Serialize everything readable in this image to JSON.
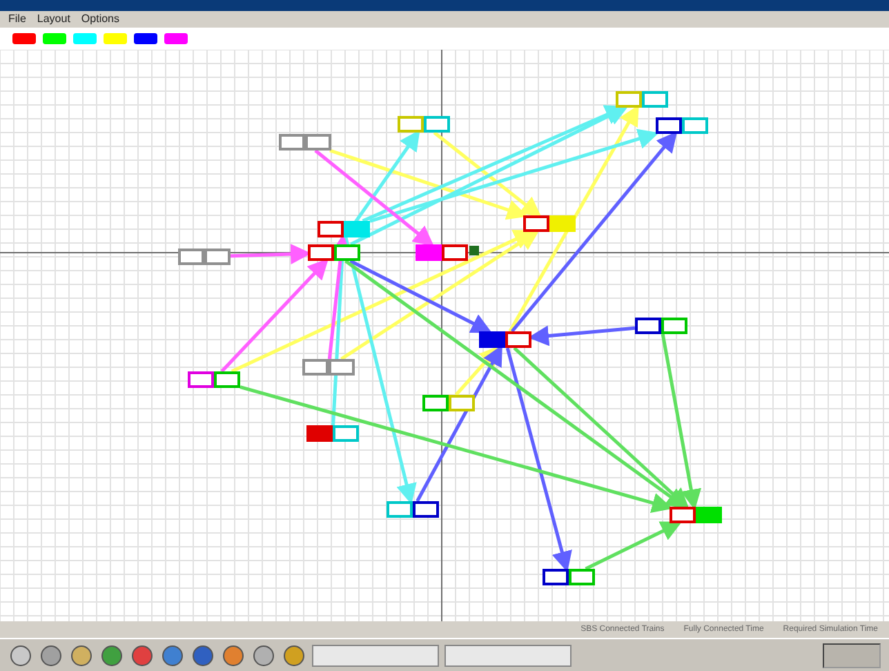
{
  "menu": [
    {
      "label": "File"
    },
    {
      "label": "Layout"
    },
    {
      "label": "Options"
    }
  ],
  "legend": [
    {
      "color": "#ff0000"
    },
    {
      "color": "#00ff00"
    },
    {
      "color": "#00ffff"
    },
    {
      "color": "#ffff00"
    },
    {
      "color": "#0000ff"
    },
    {
      "color": "#ff00ff"
    }
  ],
  "nodes": [
    {
      "left": {
        "color": "#c8c800",
        "kind": "outline"
      },
      "right": {
        "color": "#00c8c8",
        "kind": "outline"
      }
    },
    {
      "left": {
        "color": "#c8c800",
        "kind": "outline"
      },
      "right": {
        "color": "#00c8c8",
        "kind": "outline"
      }
    },
    {
      "left": {
        "color": "#0000c8",
        "kind": "outline"
      },
      "right": {
        "color": "#00c8c8",
        "kind": "outline"
      }
    },
    {
      "left": {
        "color": "#909090",
        "kind": "outline"
      },
      "right": {
        "color": "#909090",
        "kind": "outline"
      }
    },
    {
      "left": {
        "color": "#e00000",
        "kind": "outline"
      },
      "right": {
        "color": "#00e8e8",
        "kind": "solid"
      }
    },
    {
      "left": {
        "color": "#909090",
        "kind": "outline"
      },
      "right": {
        "color": "#909090",
        "kind": "outline"
      }
    },
    {
      "left": {
        "color": "#e00000",
        "kind": "outline"
      },
      "right": {
        "color": "#00c800",
        "kind": "outline"
      }
    },
    {
      "left": {
        "color": "#ff00ff",
        "kind": "solid"
      },
      "right": {
        "color": "#e00000",
        "kind": "outline"
      }
    },
    {
      "left": {
        "color": "#e00000",
        "kind": "outline"
      },
      "right": {
        "color": "#f0f000",
        "kind": "solid"
      }
    },
    {
      "left": {
        "color": "#0000e0",
        "kind": "solid"
      },
      "right": {
        "color": "#e00000",
        "kind": "outline"
      }
    },
    {
      "left": {
        "color": "#0000c8",
        "kind": "outline"
      },
      "right": {
        "color": "#00c800",
        "kind": "outline"
      }
    },
    {
      "left": {
        "color": "#e000e0",
        "kind": "outline"
      },
      "right": {
        "color": "#00c800",
        "kind": "outline"
      }
    },
    {
      "left": {
        "color": "#909090",
        "kind": "outline"
      },
      "right": {
        "color": "#909090",
        "kind": "outline"
      }
    },
    {
      "left": {
        "color": "#e00000",
        "kind": "solid"
      },
      "right": {
        "color": "#00c8c8",
        "kind": "outline"
      }
    },
    {
      "left": {
        "color": "#00c800",
        "kind": "outline"
      },
      "right": {
        "color": "#c8c800",
        "kind": "outline"
      }
    },
    {
      "left": {
        "color": "#00c8c8",
        "kind": "outline"
      },
      "right": {
        "color": "#0000c8",
        "kind": "outline"
      }
    },
    {
      "left": {
        "color": "#e00000",
        "kind": "outline"
      },
      "right": {
        "color": "#00e000",
        "kind": "solid"
      }
    },
    {
      "left": {
        "color": "#0000c8",
        "kind": "outline"
      },
      "right": {
        "color": "#00c800",
        "kind": "outline"
      }
    }
  ],
  "edges": [
    {
      "color": "#ffff60"
    },
    {
      "color": "#ffff60"
    },
    {
      "color": "#ffff60"
    },
    {
      "color": "#ffff60"
    },
    {
      "color": "#ffff60"
    },
    {
      "color": "#ffff60"
    },
    {
      "color": "#60f0f0"
    },
    {
      "color": "#60f0f0"
    },
    {
      "color": "#60f0f0"
    },
    {
      "color": "#60f0f0"
    },
    {
      "color": "#60f0f0"
    },
    {
      "color": "#60f0f0"
    },
    {
      "color": "#ff60ff"
    },
    {
      "color": "#ff60ff"
    },
    {
      "color": "#ff60ff"
    },
    {
      "color": "#ff60ff"
    },
    {
      "color": "#6060ff"
    },
    {
      "color": "#6060ff"
    },
    {
      "color": "#6060ff"
    },
    {
      "color": "#6060ff"
    },
    {
      "color": "#6060ff"
    },
    {
      "color": "#60e060"
    },
    {
      "color": "#60e060"
    },
    {
      "color": "#60e060"
    },
    {
      "color": "#60e060"
    },
    {
      "color": "#60e060"
    }
  ],
  "status": [
    {
      "label": "SBS Connected Trains"
    },
    {
      "label": "Fully Connected Time"
    },
    {
      "label": "Required Simulation Time"
    }
  ]
}
